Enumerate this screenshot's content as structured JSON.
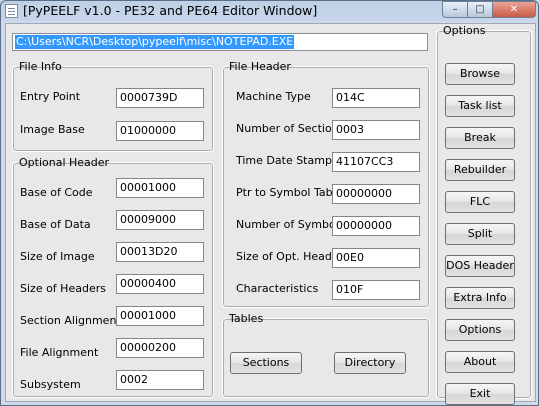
{
  "window": {
    "title": "[PyPEELF v1.0 - PE32 and PE64 Editor Window]"
  },
  "file_path": "C:\\Users\\NCR\\Desktop\\pypeelf\\misc\\NOTEPAD.EXE",
  "file_info": {
    "legend": "File Info",
    "entry_point": {
      "label": "Entry Point",
      "value": "0000739D"
    },
    "image_base": {
      "label": "Image Base",
      "value": "01000000"
    }
  },
  "optional_header": {
    "legend": "Optional Header",
    "base_of_code": {
      "label": "Base of Code",
      "value": "00001000"
    },
    "base_of_data": {
      "label": "Base of Data",
      "value": "00009000"
    },
    "size_of_image": {
      "label": "Size of Image",
      "value": "00013D20"
    },
    "size_of_headers": {
      "label": "Size of Headers",
      "value": "00000400"
    },
    "section_alignment": {
      "label": "Section Alignment",
      "value": "00001000"
    },
    "file_alignment": {
      "label": "File Alignment",
      "value": "00000200"
    },
    "subsystem": {
      "label": "Subsystem",
      "value": "0002"
    }
  },
  "file_header": {
    "legend": "File Header",
    "machine_type": {
      "label": "Machine Type",
      "value": "014C"
    },
    "number_of_sections": {
      "label": "Number of Sections",
      "value": "0003"
    },
    "time_date_stamp": {
      "label": "Time Date Stamp",
      "value": "41107CC3"
    },
    "ptr_to_symbol_table": {
      "label": "Ptr to Symbol Table",
      "value": "00000000"
    },
    "number_of_symbols": {
      "label": "Number of Symbols",
      "value": "00000000"
    },
    "size_of_opt_header": {
      "label": "Size of Opt. Header",
      "value": "00E0"
    },
    "characteristics": {
      "label": "Characteristics",
      "value": "010F"
    }
  },
  "tables": {
    "legend": "Tables",
    "sections_label": "Sections",
    "directory_label": "Directory"
  },
  "options": {
    "legend": "Options",
    "browse": "Browse",
    "task_list": "Task list",
    "break": "Break",
    "rebuilder": "Rebuilder",
    "flc": "FLC",
    "split": "Split",
    "dos_header": "DOS Header",
    "extra_info": "Extra Info",
    "options": "Options",
    "about": "About",
    "exit": "Exit"
  }
}
